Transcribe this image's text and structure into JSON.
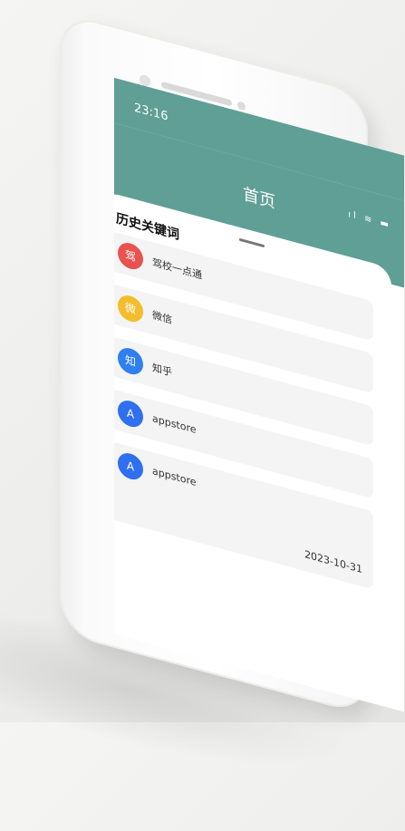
{
  "status": {
    "time": "23:16",
    "icons": "..ıl ᯤ ▭"
  },
  "header": {
    "title": "首页",
    "icons": "ıl ≋ ▬"
  },
  "history": {
    "title": "历史关键词",
    "items": [
      {
        "label": "驾校一点通",
        "icon_text": "驾",
        "icon_color": "#e8534f"
      },
      {
        "label": "微信",
        "icon_text": "微",
        "icon_color": "#f3bd2d"
      },
      {
        "label": "知乎",
        "icon_text": "知",
        "icon_color": "#2f7ff0"
      },
      {
        "label": "appstore",
        "icon_text": "A",
        "icon_color": "#2f6ff0"
      },
      {
        "label": "appstore",
        "icon_text": "A",
        "icon_color": "#2f6ff0",
        "date": "2023-10-31"
      }
    ]
  },
  "colors": {
    "header_bg": "#5f9f96",
    "card_bg": "#f4f4f4"
  }
}
